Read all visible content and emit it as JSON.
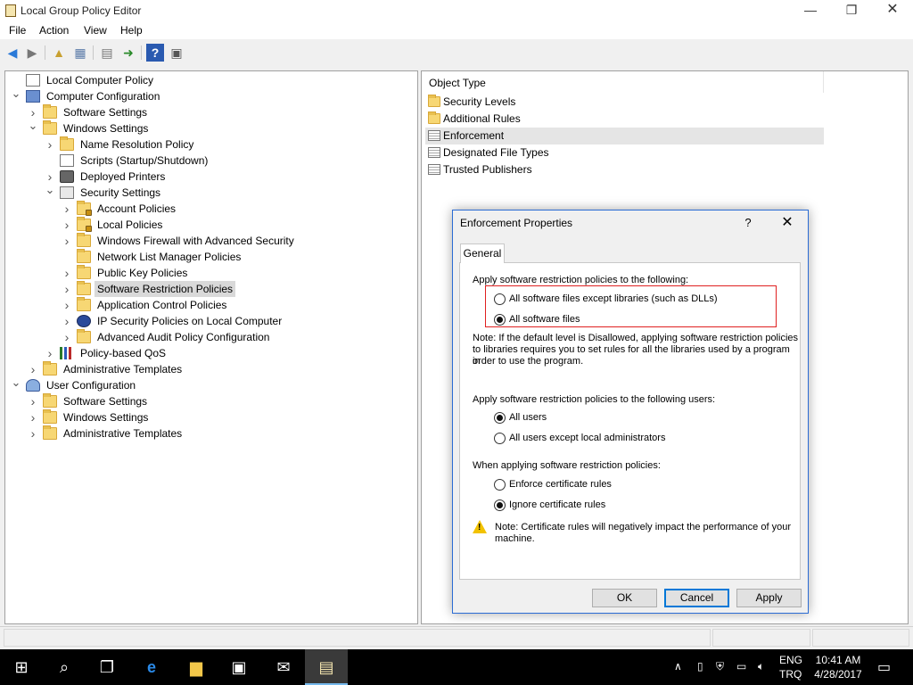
{
  "window": {
    "title": "Local Group Policy Editor",
    "min_glyph": "—",
    "max_glyph": "❐",
    "close_glyph": "✕"
  },
  "menu": [
    "File",
    "Action",
    "View",
    "Help"
  ],
  "toolbar_icons": [
    "back-arrow-icon",
    "forward-arrow-icon",
    "up-folder-icon",
    "show-hide-tree-icon",
    "properties-icon",
    "export-list-icon",
    "help-icon",
    "console-view-icon"
  ],
  "tree": [
    {
      "label": "Local Computer Policy",
      "level": 0,
      "expander": "",
      "icon": "doc"
    },
    {
      "label": "Computer Configuration",
      "level": 0,
      "expander": "open",
      "icon": "computer"
    },
    {
      "label": "Software Settings",
      "level": 1,
      "expander": "closed",
      "icon": "folder"
    },
    {
      "label": "Windows Settings",
      "level": 1,
      "expander": "open",
      "icon": "folder"
    },
    {
      "label": "Name Resolution Policy",
      "level": 2,
      "expander": "closed",
      "icon": "folder"
    },
    {
      "label": "Scripts (Startup/Shutdown)",
      "level": 2,
      "expander": "",
      "icon": "doc"
    },
    {
      "label": "Deployed Printers",
      "level": 2,
      "expander": "closed",
      "icon": "printer"
    },
    {
      "label": "Security Settings",
      "level": 2,
      "expander": "open",
      "icon": "shield"
    },
    {
      "label": "Account Policies",
      "level": 3,
      "expander": "closed",
      "icon": "folder-lock"
    },
    {
      "label": "Local Policies",
      "level": 3,
      "expander": "closed",
      "icon": "folder-lock"
    },
    {
      "label": "Windows Firewall with Advanced Security",
      "level": 3,
      "expander": "closed",
      "icon": "folder"
    },
    {
      "label": "Network List Manager Policies",
      "level": 3,
      "expander": "",
      "icon": "folder"
    },
    {
      "label": "Public Key Policies",
      "level": 3,
      "expander": "closed",
      "icon": "folder"
    },
    {
      "label": "Software Restriction Policies",
      "level": 3,
      "expander": "closed",
      "icon": "folder",
      "selected": true
    },
    {
      "label": "Application Control Policies",
      "level": 3,
      "expander": "closed",
      "icon": "folder"
    },
    {
      "label": "IP Security Policies on Local Computer",
      "level": 3,
      "expander": "closed",
      "icon": "ipsec"
    },
    {
      "label": "Advanced Audit Policy Configuration",
      "level": 3,
      "expander": "closed",
      "icon": "folder"
    },
    {
      "label": "Policy-based QoS",
      "level": 2,
      "expander": "closed",
      "icon": "qos"
    },
    {
      "label": "Administrative Templates",
      "level": 1,
      "expander": "closed",
      "icon": "folder"
    },
    {
      "label": "User Configuration",
      "level": 0,
      "expander": "open",
      "icon": "user"
    },
    {
      "label": "Software Settings",
      "level": 1,
      "expander": "closed",
      "icon": "folder"
    },
    {
      "label": "Windows Settings",
      "level": 1,
      "expander": "closed",
      "icon": "folder"
    },
    {
      "label": "Administrative Templates",
      "level": 1,
      "expander": "closed",
      "icon": "folder"
    }
  ],
  "list": {
    "column_header": "Object Type",
    "items": [
      {
        "label": "Security Levels",
        "icon": "folder"
      },
      {
        "label": "Additional Rules",
        "icon": "folder"
      },
      {
        "label": "Enforcement",
        "icon": "doc",
        "selected": true
      },
      {
        "label": "Designated File Types",
        "icon": "doc"
      },
      {
        "label": "Trusted Publishers",
        "icon": "doc"
      }
    ]
  },
  "dialog": {
    "title": "Enforcement Properties",
    "help_glyph": "?",
    "close_glyph": "✕",
    "tab": "General",
    "section1_label": "Apply software restriction policies to the following:",
    "opt_except_libraries": "All software files except libraries (such as DLLs)",
    "opt_all_files": "All software files",
    "note1_line1": "Note:  If the default level is Disallowed, applying software restriction policies",
    "note1_line2": "to libraries requires you to set rules for all the libraries used by a program in",
    "note1_line3": "order to use the program.",
    "section2_label": "Apply software restriction policies to the following users:",
    "opt_all_users": "All users",
    "opt_except_admins": "All users except local administrators",
    "section3_label": "When applying software restriction policies:",
    "opt_enforce_cert": "Enforce certificate rules",
    "opt_ignore_cert": "Ignore certificate rules",
    "note2_line1": "Note:  Certificate rules will negatively impact the performance of your",
    "note2_line2": "machine.",
    "ok": "OK",
    "cancel": "Cancel",
    "apply": "Apply"
  },
  "taskbar": {
    "lang_line1": "ENG",
    "lang_line2": "TRQ",
    "time": "10:41 AM",
    "date": "4/28/2017"
  },
  "colors": {
    "selection": "#d9d9d9",
    "dialog_border": "#2b6cd4",
    "highlight_box": "#e02020",
    "taskbar": "#000000"
  }
}
